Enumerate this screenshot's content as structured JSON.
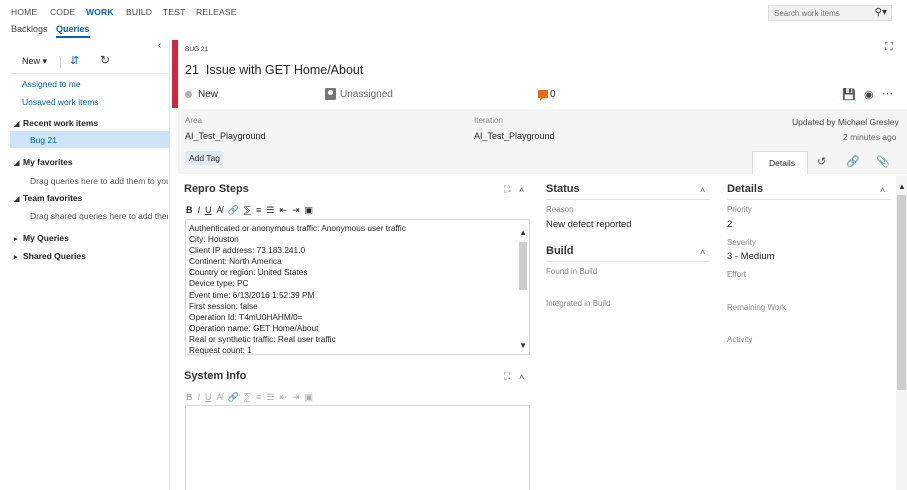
{
  "topnav": {
    "items": [
      "HOME",
      "CODE",
      "WORK",
      "BUILD",
      "TEST",
      "RELEASE"
    ],
    "search_placeholder": "Search work items"
  },
  "subnav": {
    "items": [
      "Backlogs",
      "Queries"
    ]
  },
  "left": {
    "new_label": "New",
    "links": [
      "Assigned to me",
      "Unsaved work items"
    ],
    "recent_heading": "Recent work items",
    "recent_item": "Bug 21",
    "my_favorites": "My favorites",
    "my_favorites_hint": "Drag queries here to add them to your favorites",
    "team_favorites": "Team favorites",
    "team_favorites_hint": "Drag shared queries here to add them to team favorites",
    "my_queries": "My Queries",
    "shared_queries": "Shared Queries"
  },
  "workitem": {
    "type_label": "BUG 21",
    "id": "21",
    "title": "Issue with GET Home/About",
    "state": "New",
    "assigned": "Unassigned",
    "comment_count": "0",
    "area_label": "Area",
    "area_value": "AI_Test_Playground",
    "iteration_label": "Iteration",
    "iteration_value": "AI_Test_Playground",
    "updated_by": "Updated by Michael Gresley",
    "updated_ago": "2 minutes ago",
    "add_tag": "Add Tag",
    "tab_details": "Details"
  },
  "repro": {
    "title": "Repro Steps",
    "lines": [
      "Authenticated or anonymous traffic: Anonymous user traffic",
      "City: Houston",
      "Client IP address: 73.183.241.0",
      "Continent: North America",
      "Country or region: United States",
      "Device type: PC",
      "Event time: 6/13/2016 1:52:39 PM",
      "First session: false",
      "Operation Id: T4mU0HAHM/0=",
      "Operation name: GET Home/About",
      "Real or synthetic traffic: Real user traffic",
      "Request count: 1"
    ]
  },
  "sysinfo": {
    "title": "System Info"
  },
  "status": {
    "title": "Status",
    "reason_label": "Reason",
    "reason_value": "New defect reported"
  },
  "build": {
    "title": "Build",
    "found_label": "Found in Build",
    "integrated_label": "Integrated in Build"
  },
  "details": {
    "title": "Details",
    "priority_label": "Priority",
    "priority_value": "2",
    "severity_label": "Severity",
    "severity_value": "3 - Medium",
    "effort_label": "Effort",
    "remaining_label": "Remaining Work",
    "activity_label": "Activity"
  },
  "colors": {
    "accent": "#0063b1",
    "bug_red": "#cc293d",
    "comment_orange": "#e96b0c"
  }
}
